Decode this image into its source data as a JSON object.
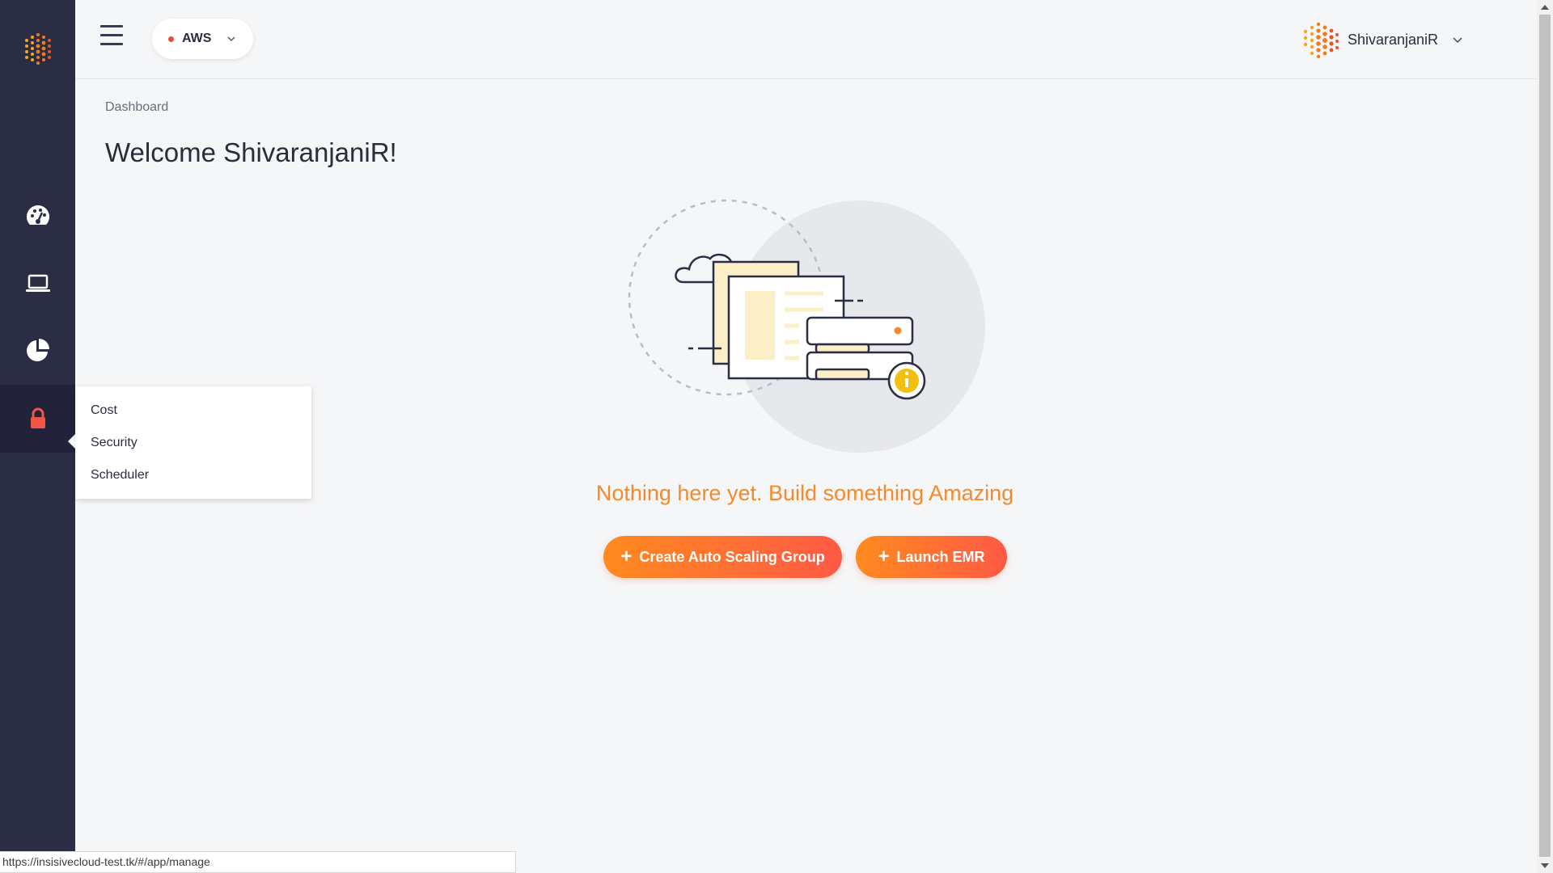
{
  "topbar": {
    "cloud_selector": {
      "value": "AWS"
    },
    "user": {
      "name": "ShivaranjaniR"
    }
  },
  "sidebar": {
    "items": [
      {
        "icon": "dashboard-gauge-icon"
      },
      {
        "icon": "laptop-icon"
      },
      {
        "icon": "pie-chart-icon"
      },
      {
        "icon": "lock-icon",
        "active": true
      }
    ]
  },
  "flyout": {
    "items": [
      "Cost",
      "Security",
      "Scheduler"
    ]
  },
  "main": {
    "breadcrumb": "Dashboard",
    "welcome": "Welcome ShivaranjaniR!",
    "empty_message": "Nothing here yet. Build something Amazing",
    "buttons": {
      "create_asg": "Create Auto Scaling Group",
      "launch_emr": "Launch EMR",
      "plus_icon": "+"
    }
  },
  "status_bar": {
    "url": "https://insisivecloud-test.tk/#/app/manage"
  },
  "colors": {
    "sidebar_bg": "#2b2d45",
    "accent_orange": "#f68a2a",
    "button_gradient_start": "#ff8a1f",
    "button_gradient_end": "#ff5a45",
    "status_dot": "#e84c3d",
    "lock_icon": "#f05545"
  }
}
